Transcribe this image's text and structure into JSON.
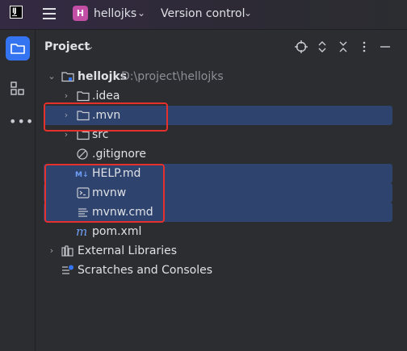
{
  "titlebar": {
    "app_logo_text": "IJ",
    "project_badge": "H",
    "project_name": "hellojks",
    "vcs_label": "Version control"
  },
  "toolstrip": {
    "items": [
      "folder-icon",
      "structure-icon",
      "more-icon"
    ]
  },
  "panel": {
    "title": "Project",
    "header_icons": [
      "locate-icon",
      "expand-collapse-icon",
      "close-all-icon",
      "options-icon",
      "hide-icon"
    ]
  },
  "tree": [
    {
      "label": "hellojks",
      "path": "D:\\project\\hellojks",
      "icon": "module-folder-icon",
      "expanded": true,
      "selected": false
    },
    {
      "label": ".idea",
      "icon": "folder-icon",
      "expanded": false,
      "selected": false
    },
    {
      "label": ".mvn",
      "icon": "folder-icon",
      "expanded": false,
      "selected": true
    },
    {
      "label": "src",
      "icon": "folder-icon",
      "expanded": false,
      "selected": false
    },
    {
      "label": ".gitignore",
      "icon": "ignore-file-icon",
      "selected": false
    },
    {
      "label": "HELP.md",
      "icon": "markdown-icon",
      "selected": true
    },
    {
      "label": "mvnw",
      "icon": "shell-script-icon",
      "selected": true
    },
    {
      "label": "mvnw.cmd",
      "icon": "text-file-icon",
      "selected": true
    },
    {
      "label": "pom.xml",
      "icon": "maven-icon",
      "selected": false
    },
    {
      "label": "External Libraries",
      "icon": "library-icon",
      "expanded": false,
      "selected": false
    },
    {
      "label": "Scratches and Consoles",
      "icon": "scratches-icon",
      "selected": false
    }
  ],
  "colors": {
    "selection": "#2e436e",
    "accent": "#3574f0",
    "annotation_box": "#e5302b",
    "badge": "#c24ea6"
  }
}
